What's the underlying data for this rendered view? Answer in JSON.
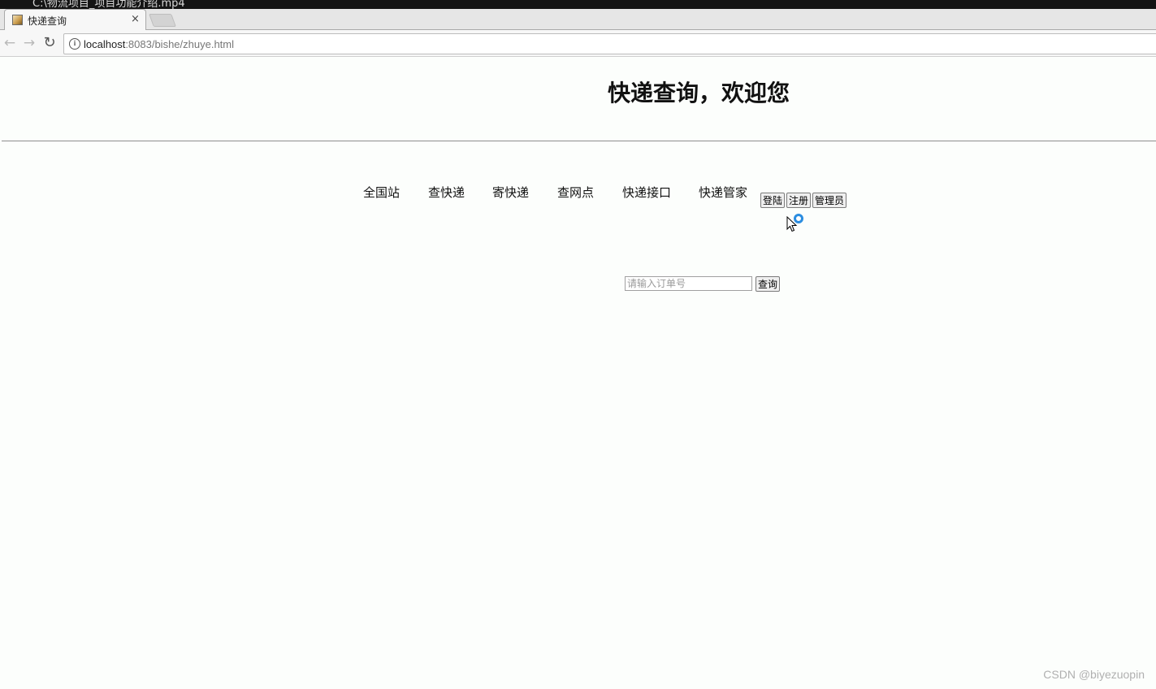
{
  "os": {
    "window_title": "C:\\物流项目_项目功能介绍.mp4"
  },
  "browser": {
    "tab": {
      "title": "快递查询",
      "close": "×"
    },
    "nav": {
      "back": "←",
      "forward": "→",
      "reload": "↻"
    },
    "address": {
      "host": "localhost",
      "rest": ":8083/bishe/zhuye.html",
      "info": "i"
    }
  },
  "page": {
    "title": "快递查询，欢迎您",
    "nav_links": [
      "全国站",
      "查快递",
      "寄快递",
      "查网点",
      "快递接口",
      "快递管家"
    ],
    "buttons": {
      "login": "登陆",
      "register": "注册",
      "admin": "管理员"
    },
    "search": {
      "placeholder": "请输入订单号",
      "value": "",
      "button": "查询"
    }
  },
  "watermark": "CSDN @biyezuopin"
}
